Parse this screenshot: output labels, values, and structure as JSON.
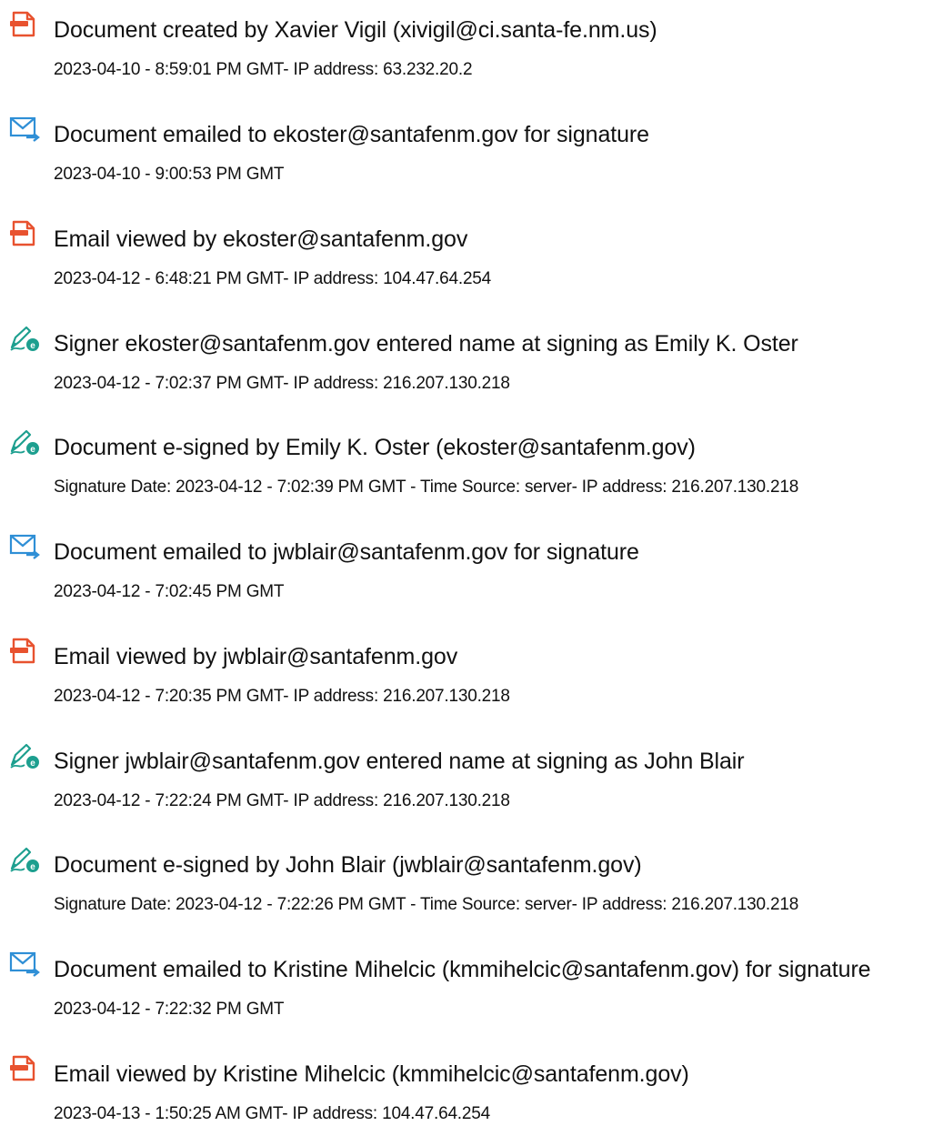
{
  "events": [
    {
      "icon": "document-created-icon",
      "title": "Document created by Xavier Vigil (xivigil@ci.santa-fe.nm.us)",
      "detail": "2023-04-10 - 8:59:01 PM GMT- IP address: 63.232.20.2"
    },
    {
      "icon": "email-sent-icon",
      "title": "Document emailed to ekoster@santafenm.gov for signature",
      "detail": "2023-04-10 - 9:00:53 PM GMT"
    },
    {
      "icon": "document-viewed-icon",
      "title": "Email viewed by ekoster@santafenm.gov",
      "detail": "2023-04-12 - 6:48:21 PM GMT- IP address: 104.47.64.254"
    },
    {
      "icon": "esign-pen-icon",
      "title": "Signer ekoster@santafenm.gov entered name at signing as Emily K. Oster",
      "detail": "2023-04-12 - 7:02:37 PM GMT- IP address: 216.207.130.218"
    },
    {
      "icon": "esign-pen-icon",
      "title": "Document e-signed by Emily K. Oster (ekoster@santafenm.gov)",
      "detail": "Signature Date: 2023-04-12 - 7:02:39 PM GMT - Time Source: server- IP address: 216.207.130.218"
    },
    {
      "icon": "email-sent-icon",
      "title": "Document emailed to jwblair@santafenm.gov for signature",
      "detail": "2023-04-12 - 7:02:45 PM GMT"
    },
    {
      "icon": "document-viewed-icon",
      "title": "Email viewed by jwblair@santafenm.gov",
      "detail": "2023-04-12 - 7:20:35 PM GMT- IP address: 216.207.130.218"
    },
    {
      "icon": "esign-pen-icon",
      "title": "Signer jwblair@santafenm.gov entered name at signing as John Blair",
      "detail": "2023-04-12 - 7:22:24 PM GMT- IP address: 216.207.130.218"
    },
    {
      "icon": "esign-pen-icon",
      "title": "Document e-signed by John Blair (jwblair@santafenm.gov)",
      "detail": "Signature Date: 2023-04-12 - 7:22:26 PM GMT - Time Source: server- IP address: 216.207.130.218"
    },
    {
      "icon": "email-sent-icon",
      "title": "Document emailed to Kristine Mihelcic (kmmihelcic@santafenm.gov) for signature",
      "detail": "2023-04-12 - 7:22:32 PM GMT"
    },
    {
      "icon": "document-viewed-icon",
      "title": "Email viewed by Kristine Mihelcic (kmmihelcic@santafenm.gov)",
      "detail": "2023-04-13 - 1:50:25 AM GMT- IP address: 104.47.64.254"
    }
  ],
  "colors": {
    "document_icon": "#e8522f",
    "email_icon": "#2f8fd6",
    "esign_pen": "#1d9f8f",
    "text": "#111111"
  }
}
